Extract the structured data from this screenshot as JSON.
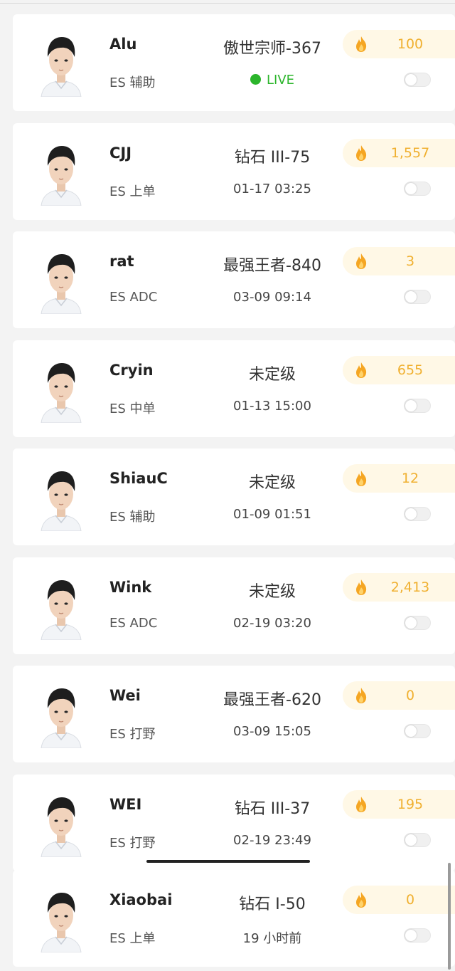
{
  "colors": {
    "live": "#2bb52b",
    "heat_bg": "#fff8e6",
    "heat_text": "#f0b030",
    "flame_outer": "#f5a623",
    "flame_inner": "#ffd36b"
  },
  "players": [
    {
      "name": "Alu",
      "role": "ES 辅助",
      "rank": "傲世宗师-367",
      "time": "LIVE",
      "live": true,
      "heat": "100",
      "heat_icon": "flame-icon"
    },
    {
      "name": "CJJ",
      "role": "ES 上单",
      "rank": "钻石 III-75",
      "time": "01-17 03:25",
      "live": false,
      "heat": "1,557",
      "heat_icon": "flame-icon"
    },
    {
      "name": "rat",
      "role": "ES ADC",
      "rank": "最强王者-840",
      "time": "03-09 09:14",
      "live": false,
      "heat": "3",
      "heat_icon": "flame-icon"
    },
    {
      "name": "Cryin",
      "role": "ES 中单",
      "rank": "未定级",
      "time": "01-13 15:00",
      "live": false,
      "heat": "655",
      "heat_icon": "flame-icon"
    },
    {
      "name": "ShiauC",
      "role": "ES 辅助",
      "rank": "未定级",
      "time": "01-09 01:51",
      "live": false,
      "heat": "12",
      "heat_icon": "flame-icon"
    },
    {
      "name": "Wink",
      "role": "ES ADC",
      "rank": "未定级",
      "time": "02-19 03:20",
      "live": false,
      "heat": "2,413",
      "heat_icon": "flame-icon"
    },
    {
      "name": "Wei",
      "role": "ES 打野",
      "rank": "最强王者-620",
      "time": "03-09 15:05",
      "live": false,
      "heat": "0",
      "heat_icon": "flame-icon"
    },
    {
      "name": "WEI",
      "role": "ES 打野",
      "rank": "钻石 III-37",
      "time": "02-19 23:49",
      "live": false,
      "heat": "195",
      "heat_icon": "flame-icon"
    },
    {
      "name": "Xiaobai",
      "role": "ES 上单",
      "rank": "钻石 I-50",
      "time": "19 小时前",
      "live": false,
      "heat": "0",
      "heat_icon": "flame-icon"
    }
  ]
}
